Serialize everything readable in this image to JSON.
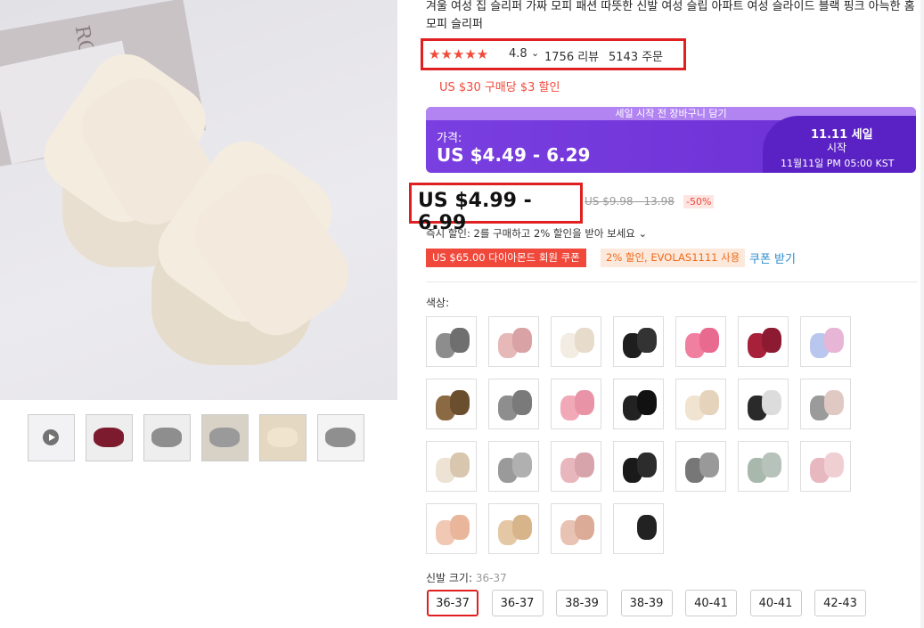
{
  "product": {
    "title": "겨울 여성 집 슬리퍼 가짜 모피 패션 따뜻한 신발 여성 슬립 아파트 여성 슬라이드 블랙 핑크 아늑한 홈 모피 슬리퍼",
    "box_text": "ROLF"
  },
  "rating": {
    "stars": "★★★★★",
    "score": "4.8",
    "chevron": "⌄",
    "reviews": "1756 리뷰",
    "orders": "5143 주문"
  },
  "promo": "US $30 구매당 $3 할인",
  "banner": {
    "top": "세일 시작 전 장바구니 담기",
    "label": "가격:",
    "price": "US $4.49 - 6.29",
    "sale": "11.11 세일",
    "start": "시작",
    "date": "11월11일 PM 05:00 KST",
    "color": "#7a3fe0"
  },
  "price": {
    "current": "US $4.99 - 6.99",
    "original": "US $9.98 - 13.98",
    "discount": "-50%"
  },
  "instant": "즉시 할인: 2를 구매하고 2% 할인을 받아 보세요 ⌄",
  "coupons": {
    "diamond": "US $65.00 다이아몬드 회원 쿠폰",
    "code": "2% 할인, EVOLAS1111 사용",
    "link": "쿠폰 받기"
  },
  "color_label": "색상:",
  "swatches": [
    {
      "a": "#8d8d8d",
      "b": "#6f6f6f"
    },
    {
      "a": "#e6b8b8",
      "b": "#d9a3a6"
    },
    {
      "a": "#f2ece2",
      "b": "#e7dccb"
    },
    {
      "a": "#1e1e1e",
      "b": "#333"
    },
    {
      "a": "#f07fa0",
      "b": "#e86a8f"
    },
    {
      "a": "#a8213a",
      "b": "#8c1a30"
    },
    {
      "a": "#b9c6ee",
      "b": "#e7b5d6"
    },
    {
      "a": "#8b6a43",
      "b": "#6b4e2e"
    },
    {
      "a": "#8e8e8e",
      "b": "#7a7a7a"
    },
    {
      "a": "#f1a9b8",
      "b": "#e893a6"
    },
    {
      "a": "#222",
      "b": "#111"
    },
    {
      "a": "#f0e3d0",
      "b": "#e6d3bb"
    },
    {
      "a": "#2a2a2a",
      "b": "#dcdcdc"
    },
    {
      "a": "#9b9b9b",
      "b": "#e0c9c3"
    },
    {
      "a": "#ede3d5",
      "b": "#d9c6ae"
    },
    {
      "a": "#9a9a9a",
      "b": "#b0b0b0"
    },
    {
      "a": "#e8b6bd",
      "b": "#d8a4ab"
    },
    {
      "a": "#1a1a1a",
      "b": "#2c2c2c"
    },
    {
      "a": "#777",
      "b": "#999"
    },
    {
      "a": "#a9b8ad",
      "b": "#b6c2ba"
    },
    {
      "a": "#e7b8bf",
      "b": "#f0cfd3"
    },
    {
      "a": "#f1c8b3",
      "b": "#e9b69c"
    },
    {
      "a": "#e4c7a4",
      "b": "#d8b48a"
    },
    {
      "a": "#e8c2b2",
      "b": "#dbab98"
    },
    {
      "a": "#ffffff",
      "b": "#222"
    }
  ],
  "size": {
    "label": "신발 크기:",
    "selected": "36-37",
    "options": [
      "36-37",
      "36-37",
      "38-39",
      "38-39",
      "40-41",
      "40-41",
      "42-43"
    ]
  }
}
